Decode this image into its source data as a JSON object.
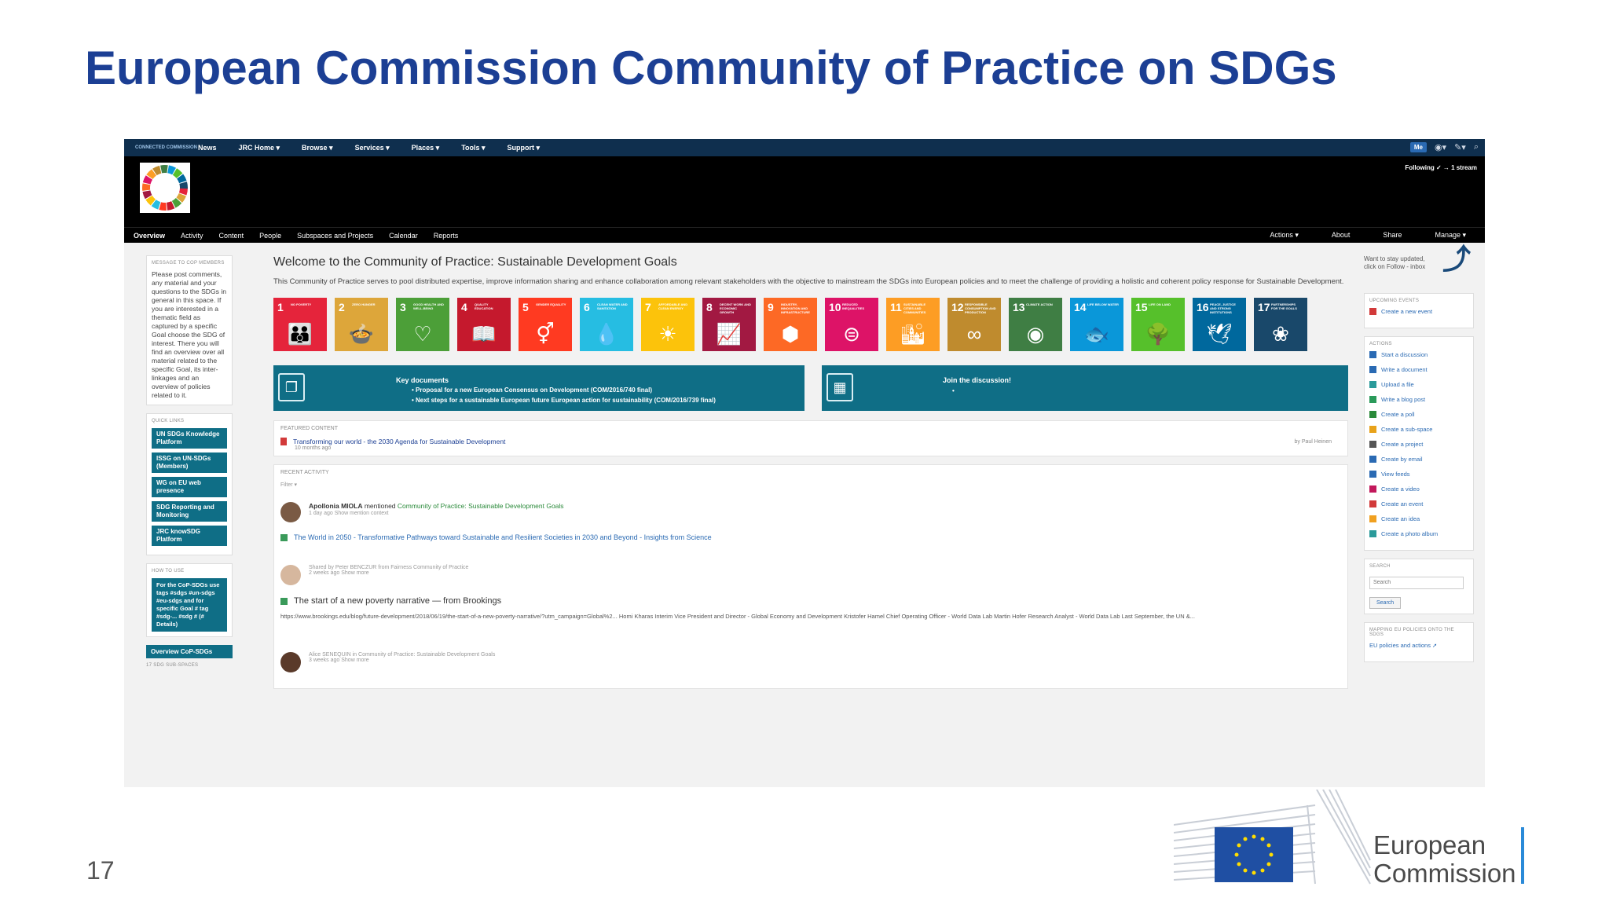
{
  "slide": {
    "title": "European Commission Community of Practice on SDGs",
    "page_number": "17"
  },
  "topnav": {
    "brand": "CONNECTED COMMISSION",
    "items": [
      "News",
      "JRC Home ▾",
      "Browse ▾",
      "Services ▾",
      "Places ▾",
      "Tools ▾",
      "Support ▾"
    ],
    "me": "Me"
  },
  "header": {
    "following": "Following ✓ → 1 stream"
  },
  "subnav": {
    "items": [
      "Overview",
      "Activity",
      "Content",
      "People",
      "Subspaces and Projects",
      "Calendar",
      "Reports"
    ],
    "right_items": [
      "Actions ▾",
      "About",
      "Share",
      "Manage ▾"
    ]
  },
  "left": {
    "message_title": "MESSAGE TO CoP MEMBERS",
    "message_body": "Please post comments, any material and your questions to the SDGs in general in this space. If you are interested in a thematic field as captured by a specific Goal choose the SDG of interest. There you will find an overview over all material related to the specific Goal, its inter-linkages and an overview of policies related to it.",
    "quick_links_title": "QUICK LINKS",
    "quick_links": [
      "UN SDGs Knowledge Platform",
      "ISSG on UN-SDGs (Members)",
      "WG on EU web presence",
      "SDG Reporting and Monitoring",
      "JRC knowSDG Platform"
    ],
    "howto_title": "HOW TO USE",
    "howto_body": "For the CoP-SDGs use tags #sdgs #un-sdgs #eu-sdgs and for specific Goal # tag #sdg-... #sdg # (# Details)",
    "overview_button": "Overview CoP-SDGs",
    "subspaces_title": "17 SDG SUB-SPACES"
  },
  "main": {
    "welcome_title": "Welcome to the Community of Practice: Sustainable Development Goals",
    "welcome_text": "This Community of Practice serves to pool distributed expertise, improve information sharing and enhance collaboration among relevant stakeholders with the objective to mainstream the SDGs into European policies and to meet the challenge of providing a holistic and coherent policy response for Sustainable Development.",
    "sdgs": [
      {
        "num": "1",
        "label": "NO POVERTY",
        "color": "#e5243b",
        "glyph": "👪"
      },
      {
        "num": "2",
        "label": "ZERO HUNGER",
        "color": "#dda63a",
        "glyph": "🍲"
      },
      {
        "num": "3",
        "label": "GOOD HEALTH AND WELL-BEING",
        "color": "#4c9f38",
        "glyph": "♡"
      },
      {
        "num": "4",
        "label": "QUALITY EDUCATION",
        "color": "#c5192d",
        "glyph": "📖"
      },
      {
        "num": "5",
        "label": "GENDER EQUALITY",
        "color": "#ff3a21",
        "glyph": "⚥"
      },
      {
        "num": "6",
        "label": "CLEAN WATER AND SANITATION",
        "color": "#26bde2",
        "glyph": "💧"
      },
      {
        "num": "7",
        "label": "AFFORDABLE AND CLEAN ENERGY",
        "color": "#fcc30b",
        "glyph": "☀"
      },
      {
        "num": "8",
        "label": "DECENT WORK AND ECONOMIC GROWTH",
        "color": "#a21942",
        "glyph": "📈"
      },
      {
        "num": "9",
        "label": "INDUSTRY, INNOVATION AND INFRASTRUCTURE",
        "color": "#fd6925",
        "glyph": "⬢"
      },
      {
        "num": "10",
        "label": "REDUCED INEQUALITIES",
        "color": "#dd1367",
        "glyph": "⊜"
      },
      {
        "num": "11",
        "label": "SUSTAINABLE CITIES AND COMMUNITIES",
        "color": "#fd9d24",
        "glyph": "🏙"
      },
      {
        "num": "12",
        "label": "RESPONSIBLE CONSUMPTION AND PRODUCTION",
        "color": "#bf8b2e",
        "glyph": "∞"
      },
      {
        "num": "13",
        "label": "CLIMATE ACTION",
        "color": "#3f7e44",
        "glyph": "◉"
      },
      {
        "num": "14",
        "label": "LIFE BELOW WATER",
        "color": "#0a97d9",
        "glyph": "🐟"
      },
      {
        "num": "15",
        "label": "LIFE ON LAND",
        "color": "#56c02b",
        "glyph": "🌳"
      },
      {
        "num": "16",
        "label": "PEACE, JUSTICE AND STRONG INSTITUTIONS",
        "color": "#00689d",
        "glyph": "🕊"
      },
      {
        "num": "17",
        "label": "PARTNERSHIPS FOR THE GOALS",
        "color": "#19486a",
        "glyph": "❀"
      }
    ],
    "key_docs_title": "Key documents",
    "key_docs": [
      "• Proposal for a new European Consensus on Development (COM/2016/740 final)",
      "• Next steps for a sustainable European future European action for sustainability (COM/2016/739 final)"
    ],
    "join_title": "Join the discussion!",
    "featured_label": "FEATURED CONTENT",
    "featured_title": "Transforming our world - the 2030 Agenda for Sustainable Development",
    "featured_age": "10 months ago",
    "featured_by": "by Paul Heinen",
    "recent_label": "RECENT ACTIVITY",
    "filter": "Filter ▾",
    "act1_who": "Apollonia MIOLA",
    "act1_verb": " mentioned ",
    "act1_link": "Community of Practice: Sustainable Development Goals",
    "act1_meta": "1 day ago  Show mention context",
    "act1_doc": "The World in 2050 - Transformative Pathways toward Sustainable and Resilient Societies in 2030 and Beyond - Insights from Science",
    "act2_meta": "Shared by Peter BENCZUR from Fairness Community of Practice",
    "act2_time": "2 weeks ago  Show more",
    "act2_headline": "The start of a new poverty narrative — from Brookings",
    "act2_url": "https://www.brookings.edu/blog/future-development/2018/06/19/the-start-of-a-new-poverty-narrative/?utm_campaign=Global%2... Homi Kharas Interim Vice President and Director - Global Economy and Development Kristofer Hamel Chief Operating Officer - World Data Lab Martin Hofer Research Analyst - World Data Lab   Last September, the UN &...",
    "act3_meta": "Alice SENEQUIN in Community of Practice: Sustainable Development Goals",
    "act3_time": "3 weeks ago  Show more"
  },
  "right": {
    "stay_updated": "Want to stay updated, click on Follow - inbox",
    "events_title": "UPCOMING EVENTS",
    "create_event": "Create a new event",
    "actions_title": "ACTIONS",
    "actions": [
      {
        "label": "Start a discussion",
        "color": "#2a6ab3"
      },
      {
        "label": "Write a document",
        "color": "#2a6ab3"
      },
      {
        "label": "Upload a file",
        "color": "#2a9a9a"
      },
      {
        "label": "Write a blog post",
        "color": "#2a9a5a"
      },
      {
        "label": "Create a poll",
        "color": "#2a8a3a"
      },
      {
        "label": "Create a sub-space",
        "color": "#e8a21a"
      },
      {
        "label": "Create a project",
        "color": "#555555"
      },
      {
        "label": "Create by email",
        "color": "#2a6ab3"
      },
      {
        "label": "View feeds",
        "color": "#2a6ab3"
      },
      {
        "label": "Create a video",
        "color": "#c2185b"
      },
      {
        "label": "Create an event",
        "color": "#d23a3a"
      },
      {
        "label": "Create an idea",
        "color": "#f0a020"
      },
      {
        "label": "Create a photo album",
        "color": "#2a9a9a"
      }
    ],
    "search_title": "SEARCH",
    "search_placeholder": "Search",
    "search_button": "Search",
    "mapping_title": "MAPPING EU POLICIES ONTO THE SDGS",
    "mapping_link": "EU policies and actions ➚"
  },
  "logo": {
    "line1": "European",
    "line2": "Commission"
  }
}
